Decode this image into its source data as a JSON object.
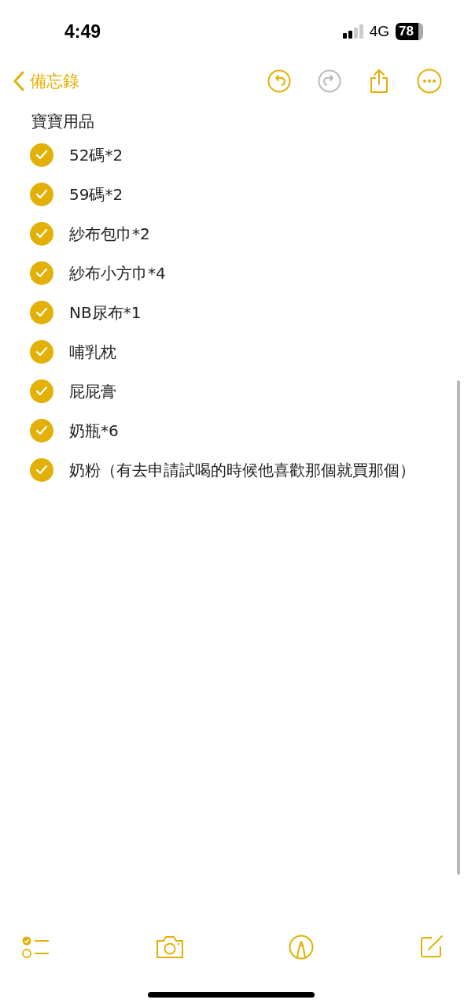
{
  "status_bar": {
    "time": "4:49",
    "network": "4G",
    "battery": "78"
  },
  "nav": {
    "back_label": "備忘錄",
    "undo_enabled": true,
    "redo_enabled": false
  },
  "note": {
    "title": "寶寶用品",
    "checklist": [
      {
        "text": "52碼*2",
        "checked": true
      },
      {
        "text": "59碼*2",
        "checked": true
      },
      {
        "text": "紗布包巾*2",
        "checked": true
      },
      {
        "text": "紗布小方巾*4",
        "checked": true
      },
      {
        "text": "NB尿布*1",
        "checked": true
      },
      {
        "text": "哺乳枕",
        "checked": true
      },
      {
        "text": "屁屁膏",
        "checked": true
      },
      {
        "text": "奶瓶*6",
        "checked": true
      },
      {
        "text": "奶粉（有去申請試喝的時候他喜歡那個就買那個）",
        "checked": true
      }
    ]
  }
}
